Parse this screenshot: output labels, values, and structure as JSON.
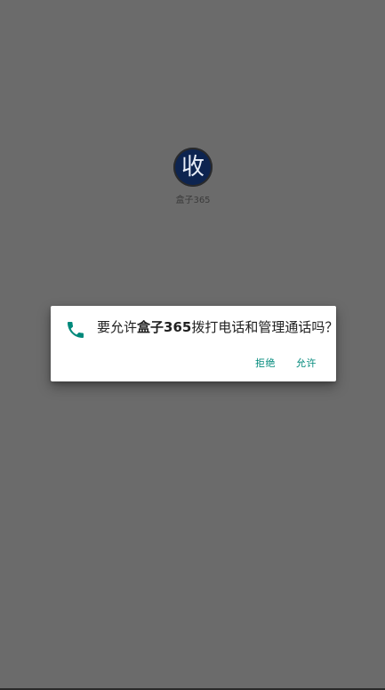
{
  "home": {
    "app_icon_glyph": "收",
    "app_name": "盒子365"
  },
  "dialog": {
    "icon": "phone-icon",
    "message_prefix": "要允许",
    "app_name_bold": "盒子365",
    "message_suffix": "拨打电话和管理通话吗？",
    "deny_label": "拒绝",
    "allow_label": "允许"
  },
  "colors": {
    "scrim": "#6b6b6b",
    "accent": "#00897b",
    "app_icon_bg": "#0d2450",
    "dialog_bg": "#ffffff"
  }
}
